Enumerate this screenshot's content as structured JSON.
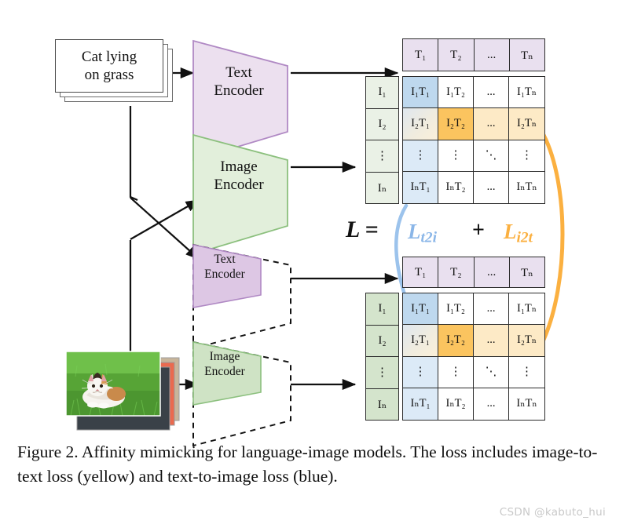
{
  "figure": {
    "caption": "Figure 2. Affinity mimicking for language-image models. The loss includes image-to-text loss (yellow) and text-to-image loss (blue).",
    "watermark": "CSDN @kabuto_hui"
  },
  "inputs": {
    "text_prompt_line1": "Cat lying",
    "text_prompt_line2": "on grass",
    "image_alt": "cat lying on grass photograph"
  },
  "teacher": {
    "text_encoder": {
      "line1": "Text",
      "line2": "Encoder"
    },
    "image_encoder": {
      "line1": "Image",
      "line2": "Encoder"
    }
  },
  "student": {
    "text_encoder": {
      "line1": "Text",
      "line2": "Encoder"
    },
    "image_encoder": {
      "line1": "Image",
      "line2": "Encoder"
    }
  },
  "equation": {
    "lhs": "L",
    "equals": "=",
    "term_t2i": "L",
    "term_t2i_sub": "t2i",
    "plus": "+",
    "term_i2t": "L",
    "term_i2t_sub": "i2t"
  },
  "matrix": {
    "image_labels": [
      "I₁",
      "I₂",
      "⋮",
      "Iₙ"
    ],
    "text_labels": [
      "T₁",
      "T₂",
      "...",
      "Tₙ"
    ],
    "cells": [
      [
        "I₁T₁",
        "I₁T₂",
        "...",
        "I₁Tₙ"
      ],
      [
        "I₂T₁",
        "I₂T₂",
        "...",
        "I₂Tₙ"
      ],
      [
        "⋮",
        "⋮",
        "⋱",
        "⋮"
      ],
      [
        "IₙT₁",
        "IₙT₂",
        "...",
        "IₙTₙ"
      ]
    ]
  },
  "colors": {
    "text_encoder_fill": "#ece0ef",
    "text_encoder_stroke": "#b089c4",
    "image_encoder_fill": "#e2efdb",
    "image_encoder_stroke": "#8cc07e",
    "t_header_fill": "#e9e0ef",
    "i_col_teacher_fill": "#eaf1e6",
    "i_col_student_fill": "#d4e4cc",
    "blue_strong": "#bed8ee",
    "blue_light": "#dceaf7",
    "yellow_strong": "#fbc45f",
    "yellow_light": "#fdeac6",
    "loss_blue": "#8ab6e8",
    "loss_orange": "#fbb040",
    "grid_stroke": "#2b2b2b"
  }
}
